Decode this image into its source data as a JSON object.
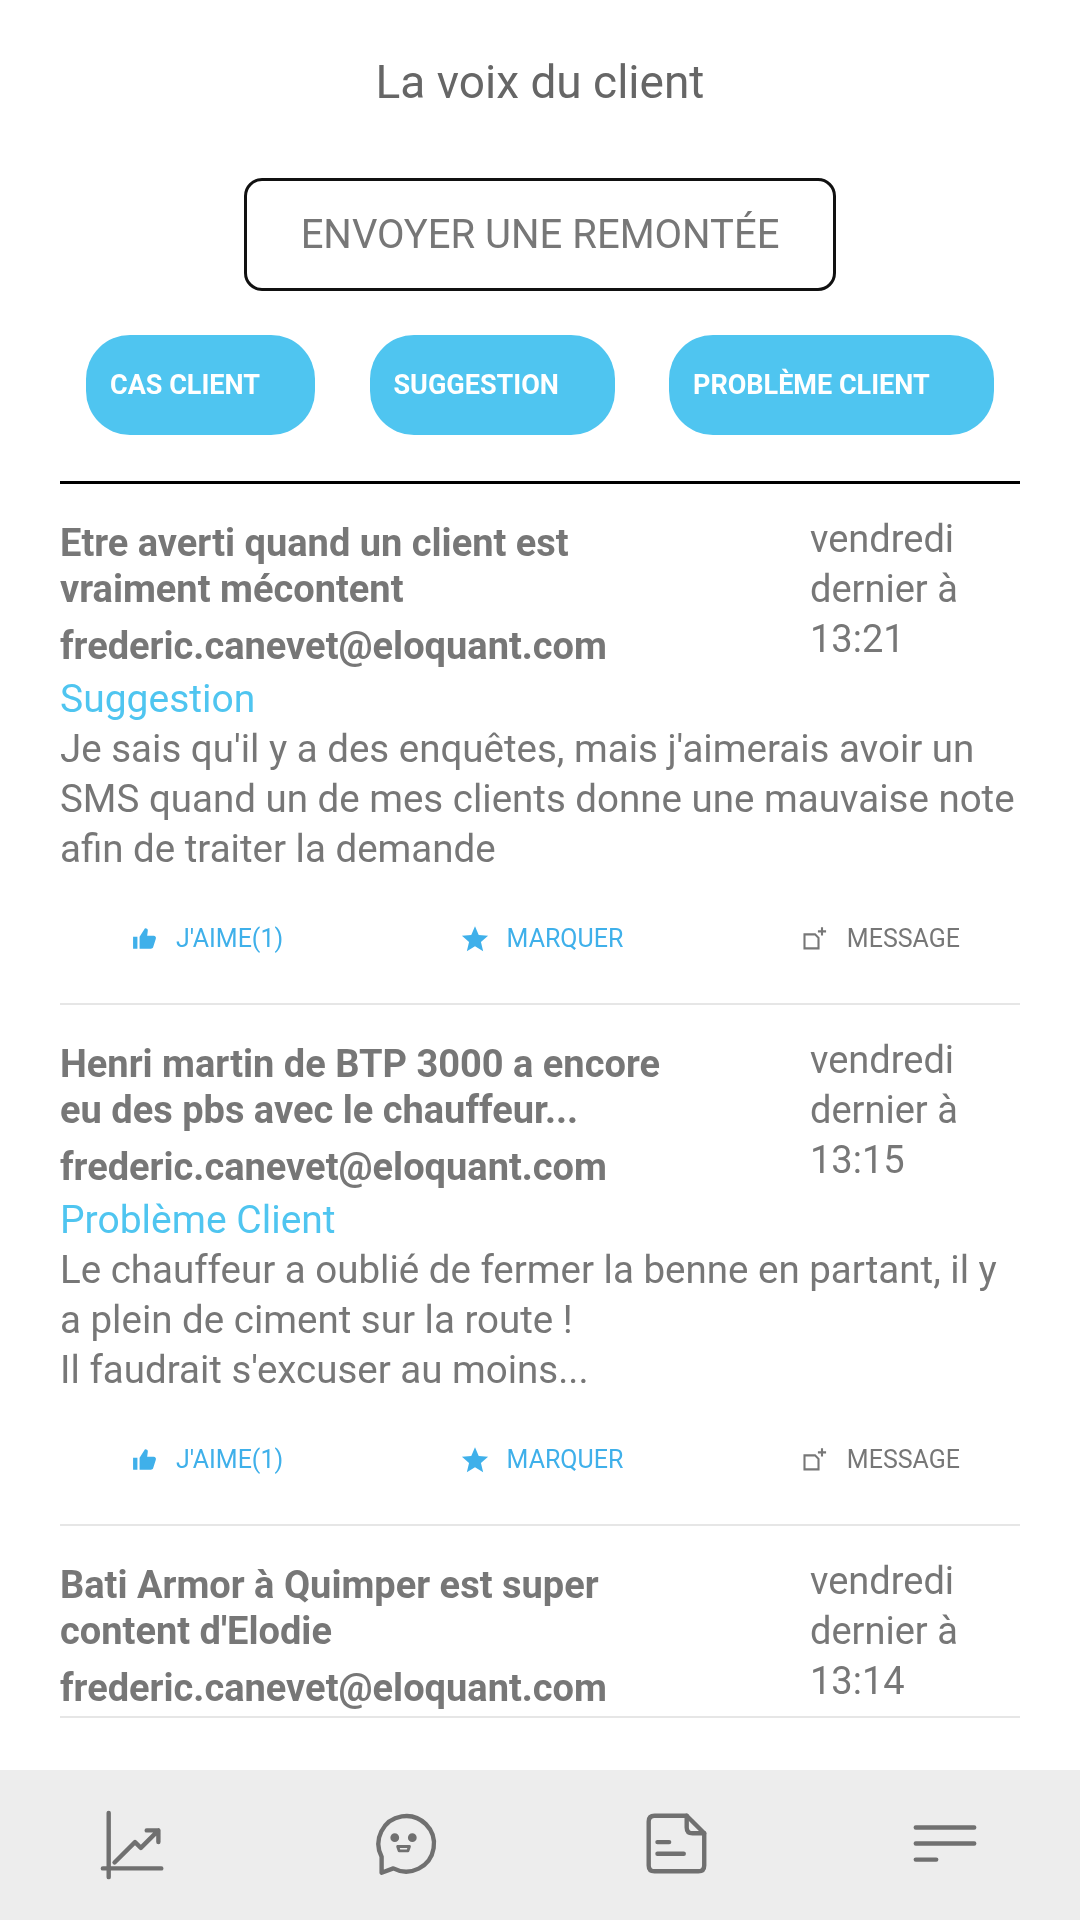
{
  "header": {
    "title": "La voix du client"
  },
  "send_button": "ENVOYER UNE REMONTÉE",
  "filters": [
    "CAS CLIENT",
    "SUGGESTION",
    "PROBLÈME CLIENT"
  ],
  "posts": [
    {
      "title": "Etre averti quand un client est vraiment mécontent",
      "author": "frederic.canevet@eloquant.com",
      "category": "Suggestion",
      "body": "Je sais qu'il y a des enquêtes, mais j'aimerais avoir un SMS quand un de mes clients donne une mauvaise note afin de traiter la demande",
      "date": "vendredi dernier à 13:21",
      "actions": [
        {
          "kind": "like",
          "label": "J'AIME(1)",
          "on": true
        },
        {
          "kind": "mark",
          "label": "MARQUER",
          "on": true
        },
        {
          "kind": "message",
          "label": "MESSAGE",
          "on": false
        }
      ]
    },
    {
      "title": "Henri martin de BTP 3000 a encore eu des pbs avec le chauffeur...",
      "author": "frederic.canevet@eloquant.com",
      "category": "Problème Client",
      "body": "Le chauffeur a oublié de fermer la benne en partant, il y a plein de ciment sur la route !\nIl faudrait s'excuser au moins...",
      "date": "vendredi dernier à 13:15",
      "actions": [
        {
          "kind": "like",
          "label": "J'AIME(1)",
          "on": true
        },
        {
          "kind": "mark",
          "label": "MARQUER",
          "on": true
        },
        {
          "kind": "message",
          "label": "MESSAGE",
          "on": false
        }
      ]
    },
    {
      "title": "Bati Armor à Quimper est super content d'Elodie",
      "author": "frederic.canevet@eloquant.com",
      "date": "vendredi dernier à 13:14"
    }
  ],
  "nav": [
    {
      "kind": "chart"
    },
    {
      "kind": "chat"
    },
    {
      "kind": "document"
    },
    {
      "kind": "menu"
    }
  ]
}
